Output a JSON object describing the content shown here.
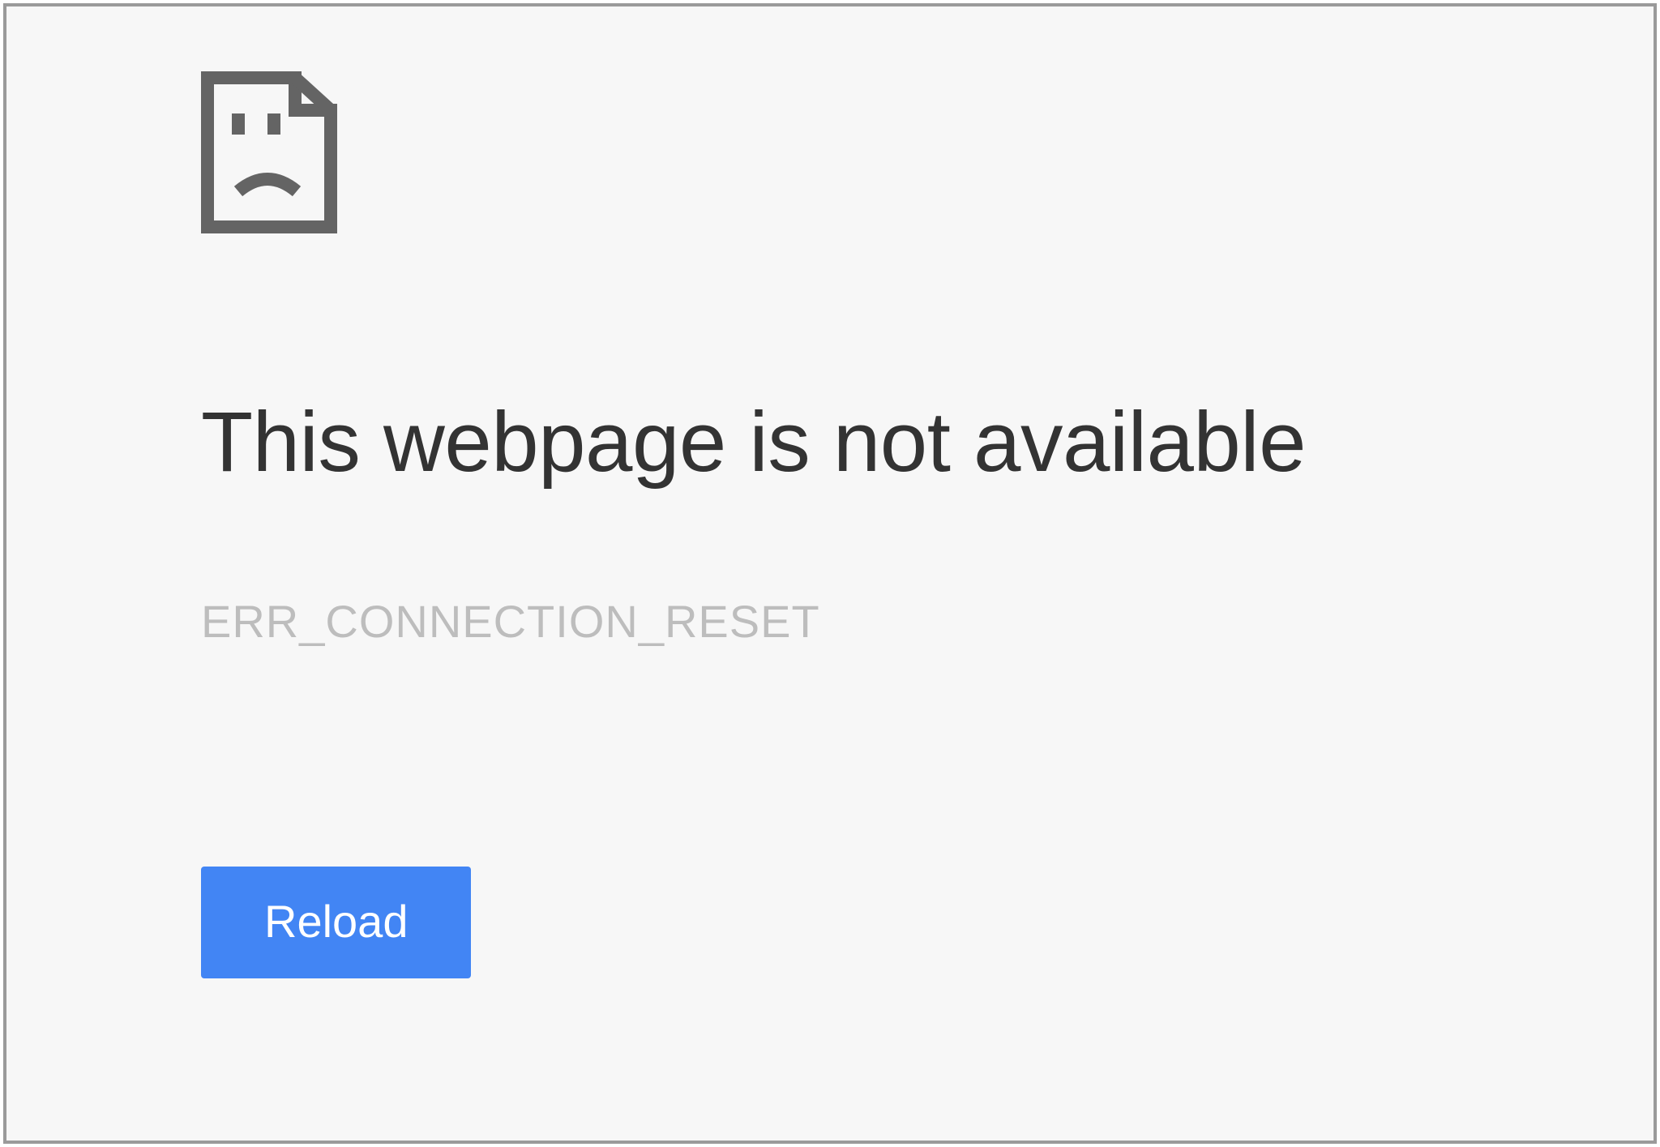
{
  "error": {
    "title": "This webpage is not available",
    "code": "ERR_CONNECTION_RESET",
    "reload_label": "Reload"
  },
  "icons": {
    "sad_page": "sad-page-icon"
  },
  "colors": {
    "accent": "#4285f4",
    "icon_stroke": "#646464",
    "title_text": "#333333",
    "muted_text": "#bdbdbd",
    "page_bg": "#f7f7f7",
    "frame_border": "#9a9a9a"
  }
}
